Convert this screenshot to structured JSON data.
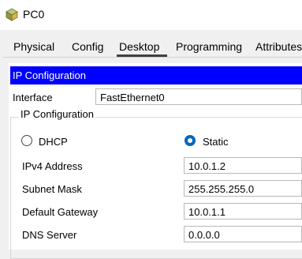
{
  "window": {
    "title": "PC0"
  },
  "tabs": [
    {
      "label": "Physical"
    },
    {
      "label": "Config"
    },
    {
      "label": "Desktop"
    },
    {
      "label": "Programming"
    },
    {
      "label": "Attributes"
    }
  ],
  "active_tab": "Desktop",
  "panel": {
    "header": "IP Configuration",
    "interface": {
      "label": "Interface",
      "value": "FastEthernet0"
    },
    "group_title": "IP Configuration",
    "mode": {
      "dhcp_label": "DHCP",
      "static_label": "Static",
      "selected": "Static"
    },
    "fields": [
      {
        "label": "IPv4 Address",
        "value": "10.0.1.2"
      },
      {
        "label": "Subnet Mask",
        "value": "255.255.255.0"
      },
      {
        "label": "Default Gateway",
        "value": "10.0.1.1"
      },
      {
        "label": "DNS Server",
        "value": "0.0.0.0"
      }
    ]
  },
  "colors": {
    "header_bg": "#0000ff",
    "radio_selected": "#0067c0"
  },
  "icons": {
    "app": "pc-icon"
  }
}
